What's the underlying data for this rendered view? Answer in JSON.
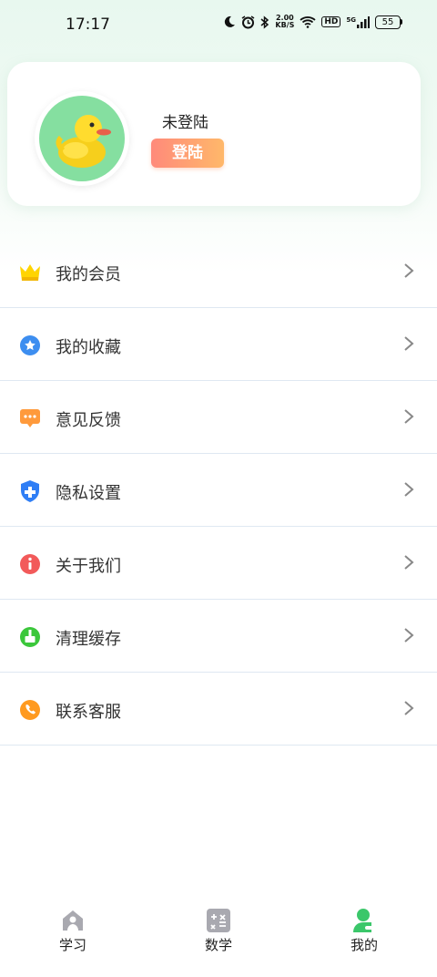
{
  "status_bar": {
    "time": "17:17",
    "speed_value": "2.00",
    "speed_unit": "KB/S",
    "hd_label": "HD",
    "network_label": "5G",
    "battery": "55"
  },
  "profile": {
    "username": "未登陆",
    "login_label": "登陆"
  },
  "menu": {
    "items": [
      {
        "label": "我的会员",
        "icon": "crown-icon"
      },
      {
        "label": "我的收藏",
        "icon": "star-icon"
      },
      {
        "label": "意见反馈",
        "icon": "message-icon"
      },
      {
        "label": "隐私设置",
        "icon": "shield-icon"
      },
      {
        "label": "关于我们",
        "icon": "info-icon"
      },
      {
        "label": "清理缓存",
        "icon": "broom-icon"
      },
      {
        "label": "联系客服",
        "icon": "phone-icon"
      }
    ]
  },
  "tabs": [
    {
      "label": "学习",
      "icon": "study-icon"
    },
    {
      "label": "数学",
      "icon": "math-icon"
    },
    {
      "label": "我的",
      "icon": "profile-icon",
      "active": true
    }
  ],
  "colors": {
    "accent_green": "#3bc76a",
    "login_gradient_start": "#ff8a7a",
    "login_gradient_end": "#ffb86a"
  }
}
